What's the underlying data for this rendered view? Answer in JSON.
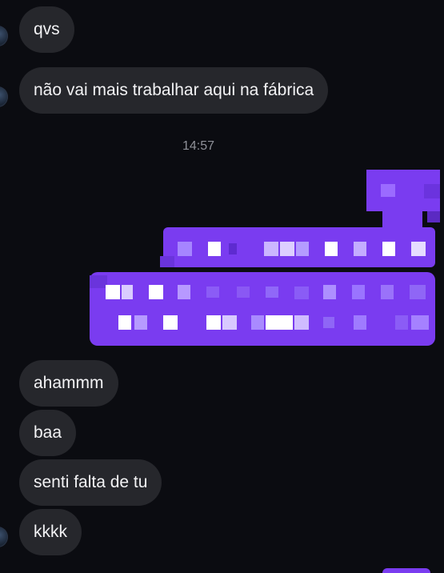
{
  "messages": {
    "incoming_top": [
      {
        "text": "qvs"
      },
      {
        "text": "não vai mais trabalhar aqui na fábrica"
      }
    ],
    "timestamp": "14:57",
    "incoming_bottom": [
      {
        "text": "ahammm"
      },
      {
        "text": "baa"
      },
      {
        "text": "senti falta de tu"
      },
      {
        "text": "kkkk"
      }
    ]
  },
  "colors": {
    "background": "#0b0c11",
    "incoming_bubble": "#26272c",
    "outgoing_bubble": "#7a3cf0",
    "text": "#f2f2f4",
    "timestamp": "#8e9098"
  },
  "outgoing": {
    "note": "outgoing messages pixelated/censored"
  }
}
